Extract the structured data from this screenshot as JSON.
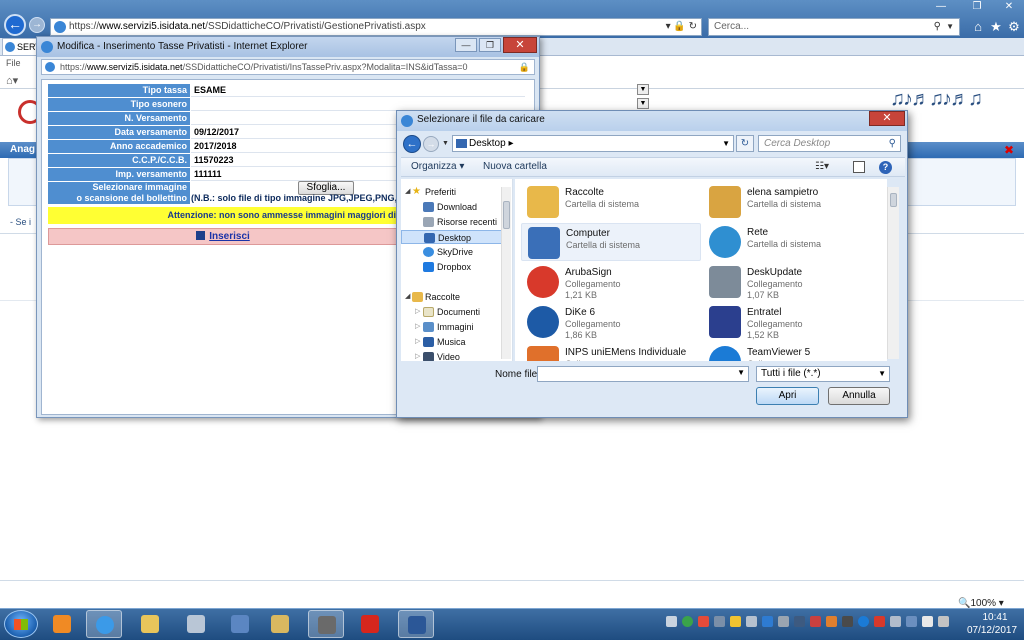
{
  "browser": {
    "url": "https://www.servizi5.isidata.net/SSDidatticheCO/Privatisti/GestionePrivatisti.aspx",
    "url_host": "www.servizi5.isidata.net",
    "url_prefix": "https://",
    "url_path": "/SSDidatticheCO/Privatisti/GestionePrivatisti.aspx",
    "search_placeholder": "Cerca...",
    "tab_label": "SERV",
    "menu_file": "File",
    "zoom": "100%"
  },
  "page": {
    "section_title": "Anag",
    "se_text": "- Se i"
  },
  "popup": {
    "title": "Modifica - Inserimento Tasse Privatisti - Internet Explorer",
    "url_prefix": "https://",
    "url_host": "www.servizi5.isidata.net",
    "url_path": "/SSDidatticheCO/Privatisti/InsTassePriv.aspx?Modalita=INS&idTassa=0",
    "fields": [
      {
        "label": "Tipo tassa",
        "value": "ESAME"
      },
      {
        "label": "Tipo esonero",
        "value": ""
      },
      {
        "label": "N. Versamento",
        "value": ""
      },
      {
        "label": "Data versamento",
        "value": "09/12/2017"
      },
      {
        "label": "Anno accademico",
        "value": "2017/2018"
      },
      {
        "label": "C.C.P./C.C.B.",
        "value": "11570223"
      },
      {
        "label": "Imp. versamento",
        "value": "111111"
      }
    ],
    "select_image_label_1": "Selezionare immagine",
    "select_image_label_2": "o scansione del bollettino",
    "browse_button": "Sfoglia...",
    "note": "(N.B.: solo file di tipo immagine JPG,JPEG,PNG,",
    "warning": "Attenzione: non sono ammesse immagini maggiori di",
    "insert_link": "Inserisci"
  },
  "file_dialog": {
    "title": "Selezionare il file da caricare",
    "location": "Desktop",
    "search_placeholder": "Cerca Desktop",
    "organize": "Organizza",
    "new_folder": "Nuova cartella",
    "nav": {
      "favorites": "Preferiti",
      "favorites_items": [
        "Download",
        "Risorse recenti",
        "Desktop",
        "SkyDrive",
        "Dropbox"
      ],
      "libraries": "Raccolte",
      "libraries_items": [
        "Documenti",
        "Immagini",
        "Musica",
        "Video"
      ]
    },
    "files": [
      {
        "name": "Raccolte",
        "type": "Cartella di sistema",
        "size": "",
        "color": "#e8b84a"
      },
      {
        "name": "elena sampietro",
        "type": "Cartella di sistema",
        "size": "",
        "color": "#d9a441"
      },
      {
        "name": "Computer",
        "type": "Cartella di sistema",
        "size": "",
        "color": "#3a6fb8"
      },
      {
        "name": "Rete",
        "type": "Cartella di sistema",
        "size": "",
        "color": "#2f8fd1"
      },
      {
        "name": "ArubaSign",
        "type": "Collegamento",
        "size": "1,21 KB",
        "color": "#d8392b"
      },
      {
        "name": "DeskUpdate",
        "type": "Collegamento",
        "size": "1,07 KB",
        "color": "#7d8b99"
      },
      {
        "name": "DiKe 6",
        "type": "Collegamento",
        "size": "1,86 KB",
        "color": "#1d5aa6"
      },
      {
        "name": "Entratel",
        "type": "Collegamento",
        "size": "1,52 KB",
        "color": "#2b3f8e"
      },
      {
        "name": "INPS uniEMens Individuale",
        "type": "Collegamento",
        "size": "",
        "color": "#e0702b"
      },
      {
        "name": "TeamViewer 5",
        "type": "Collegamento",
        "size": "",
        "color": "#1b7bd6"
      }
    ],
    "filename_label": "Nome file:",
    "filename_value": "",
    "filetype": "Tutti i file (*.*)",
    "open_button": "Apri",
    "cancel_button": "Annulla"
  },
  "taskbar": {
    "time": "10:41",
    "date": "07/12/2017"
  }
}
